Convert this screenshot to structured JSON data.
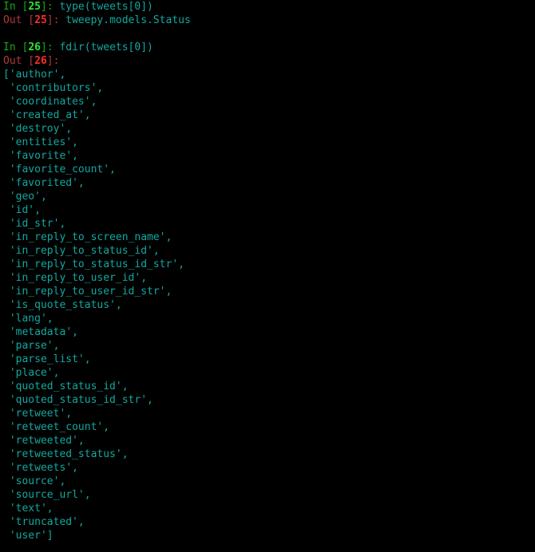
{
  "terminal": {
    "background": "#000000",
    "font_size_px": 13,
    "line_height_px": 17,
    "colors": {
      "prompt_in": "#17a81a",
      "prompt_in_number": "#2ee82e",
      "prompt_out": "#b03a3a",
      "prompt_out_number": "#ff2b2b",
      "code": "#11a7a0",
      "result": "#12a89f"
    }
  },
  "cells": [
    {
      "prompt_label": "In",
      "prompt_open": " [",
      "prompt_close": "]: ",
      "count": "25",
      "input_code": "type(tweets[0])",
      "output_label": "Out",
      "output_count": "25",
      "output_text": "tweepy.models.Status"
    },
    {
      "prompt_label": "In",
      "prompt_open": " [",
      "prompt_close": "]: ",
      "count": "26",
      "input_code": "fdir(tweets[0])",
      "output_label": "Out",
      "output_count": "26",
      "output_text": ""
    }
  ],
  "result_list": {
    "open_bracket": "[",
    "close_bracket": "]",
    "quote": "'",
    "comma": ",",
    "items": [
      "author",
      "contributors",
      "coordinates",
      "created_at",
      "destroy",
      "entities",
      "favorite",
      "favorite_count",
      "favorited",
      "geo",
      "id",
      "id_str",
      "in_reply_to_screen_name",
      "in_reply_to_status_id",
      "in_reply_to_status_id_str",
      "in_reply_to_user_id",
      "in_reply_to_user_id_str",
      "is_quote_status",
      "lang",
      "metadata",
      "parse",
      "parse_list",
      "place",
      "quoted_status_id",
      "quoted_status_id_str",
      "retweet",
      "retweet_count",
      "retweeted",
      "retweeted_status",
      "retweets",
      "source",
      "source_url",
      "text",
      "truncated",
      "user"
    ]
  }
}
